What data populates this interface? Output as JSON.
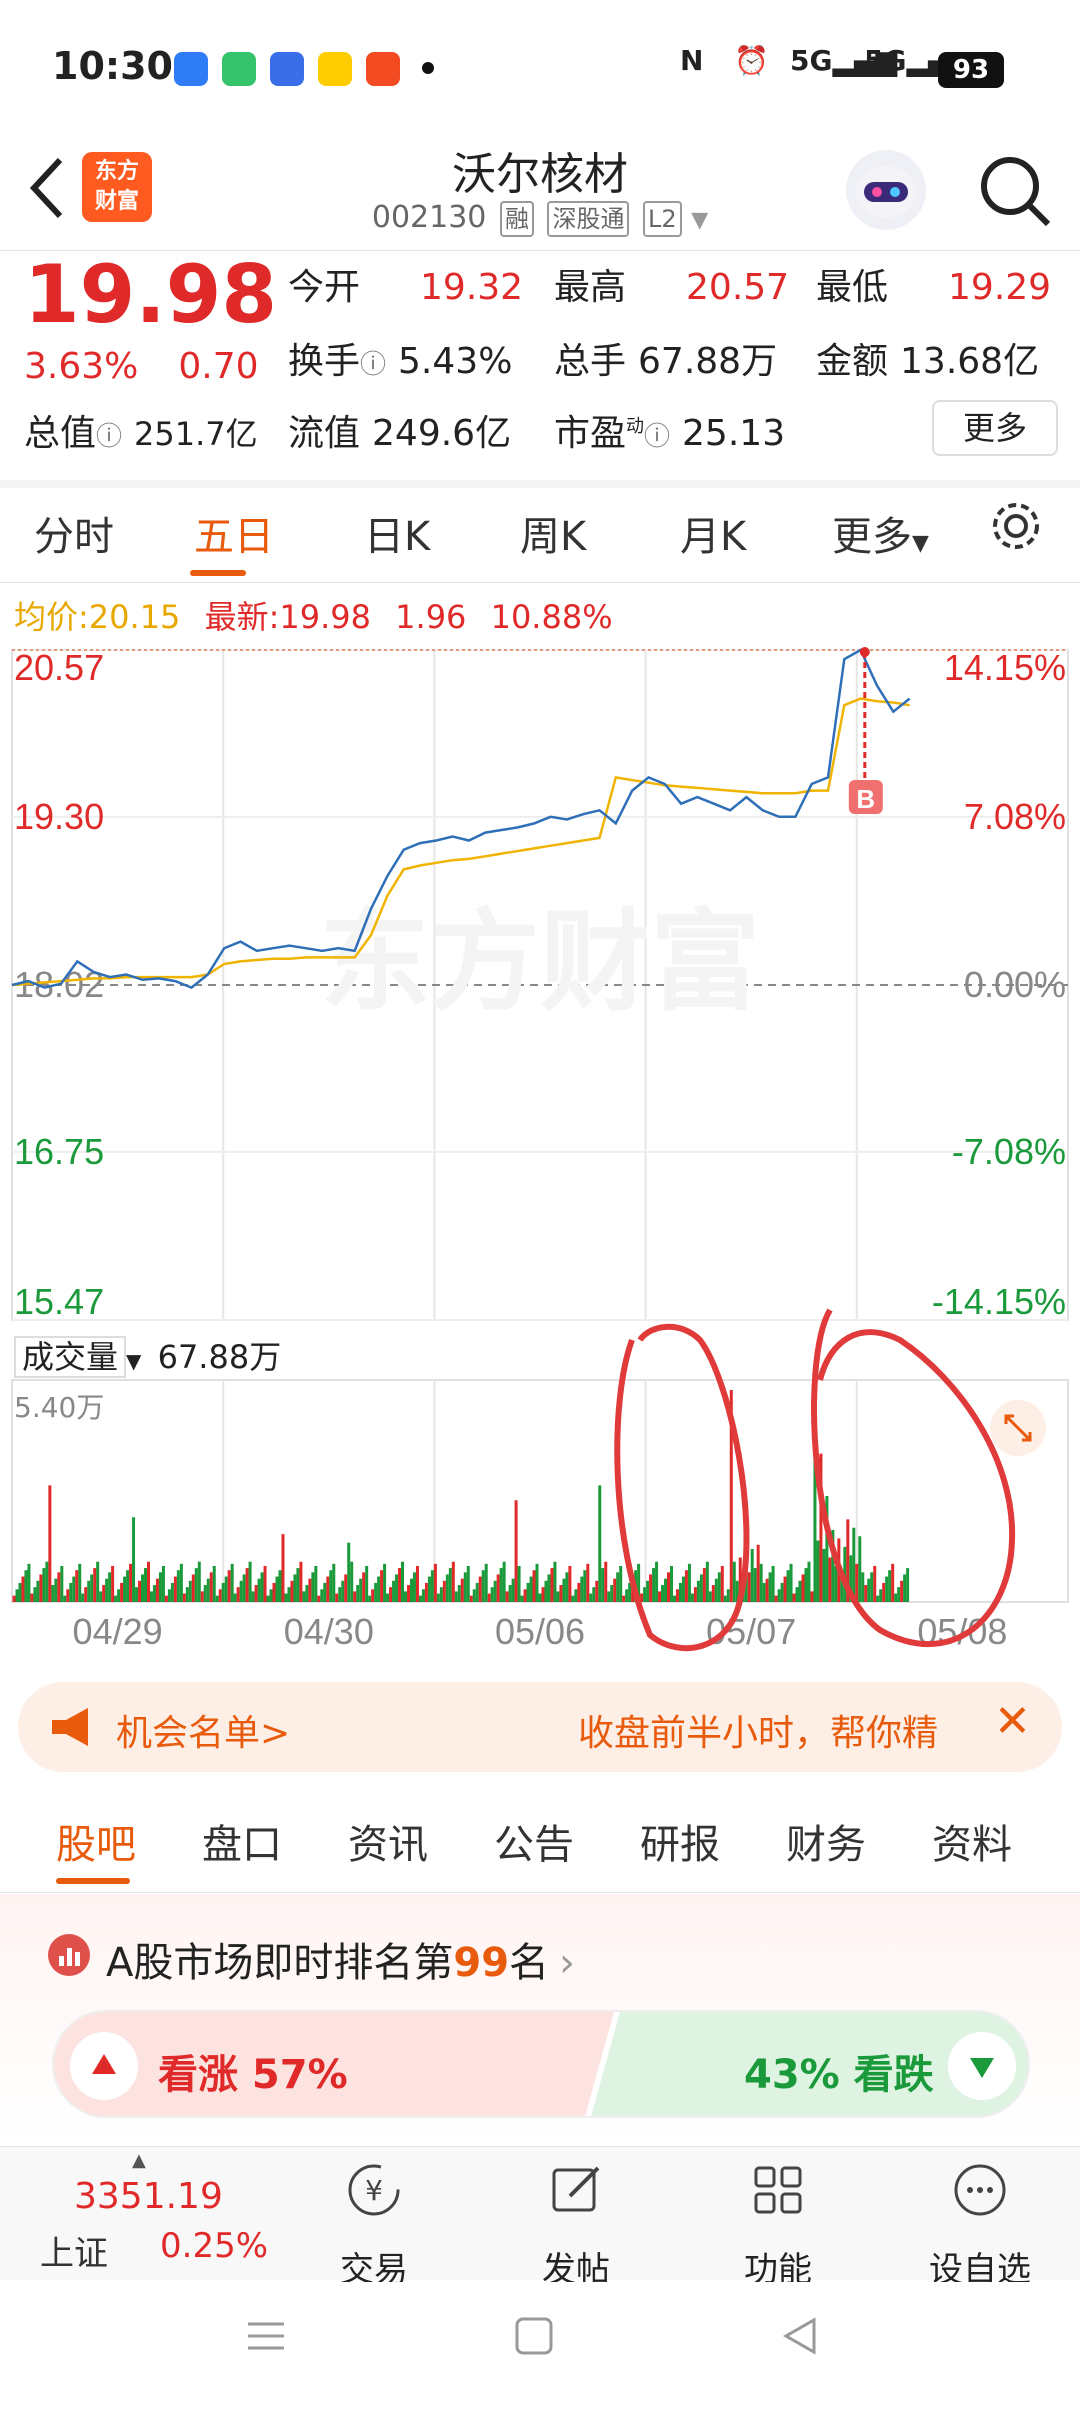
{
  "status": {
    "time": "10:30",
    "battery": "93",
    "signal1": "5G",
    "signal2": "5G"
  },
  "header": {
    "logo_line1": "东方",
    "logo_line2": "财富",
    "stock_name": "沃尔核材",
    "stock_code": "002130",
    "tags": [
      "融",
      "深股通",
      "L2"
    ],
    "back_icon": "back-chevron-icon",
    "search_icon": "search-icon"
  },
  "quote": {
    "price": "19.98",
    "pct": "3.63%",
    "change": "0.70",
    "open_label": "今开",
    "open": "19.32",
    "high_label": "最高",
    "high": "20.57",
    "low_label": "最低",
    "low": "19.29",
    "turnover_label": "换手",
    "turnover": "5.43%",
    "volume_label": "总手",
    "volume": "67.88万",
    "amount_label": "金额",
    "amount": "13.68亿",
    "mcap_label": "总值",
    "mcap": "251.7亿",
    "float_label": "流值",
    "float": "249.6亿",
    "pe_label": "市盈",
    "pe_sup": "动",
    "pe": "25.13",
    "more": "更多"
  },
  "tabs": [
    "分时",
    "五日",
    "日K",
    "周K",
    "月K",
    "更多"
  ],
  "active_tab": "五日",
  "info": {
    "avg_label": "均价:",
    "avg": "20.15",
    "latest_label": "最新:",
    "latest": "19.98",
    "latest_chg": "1.96",
    "latest_pct": "10.88%"
  },
  "chart_data": {
    "type": "line",
    "title": "",
    "x": [
      "04/29",
      "04/30",
      "05/06",
      "05/07",
      "05/08"
    ],
    "y_left_ticks": [
      "20.57",
      "19.30",
      "18.02",
      "16.75",
      "15.47"
    ],
    "y_right_ticks": [
      "14.15%",
      "7.08%",
      "0.00%",
      "-7.08%",
      "-14.15%"
    ],
    "ylim": [
      15.47,
      20.57
    ],
    "reference": 18.02,
    "series": [
      {
        "values": [
          18.02,
          18.05,
          18.0,
          18.03,
          18.2,
          18.12,
          18.08,
          18.1,
          18.06,
          18.07,
          18.05,
          18.0,
          18.1,
          18.3,
          18.35,
          18.28,
          18.3,
          18.32,
          18.3,
          18.28,
          18.3,
          18.28,
          18.6,
          18.85,
          19.05,
          19.1,
          19.12,
          19.15,
          19.12,
          19.18,
          19.2,
          19.22,
          19.25,
          19.3,
          19.28,
          19.32,
          19.35,
          19.25,
          19.5,
          19.6,
          19.55,
          19.4,
          19.45,
          19.4,
          19.35,
          19.45,
          19.35,
          19.3,
          19.3,
          19.55,
          19.6,
          20.5,
          20.57,
          20.3,
          20.1,
          20.2
        ]
      },
      {
        "values": [
          18.02,
          18.03,
          18.04,
          18.05,
          18.06,
          18.07,
          18.07,
          18.08,
          18.08,
          18.08,
          18.08,
          18.08,
          18.1,
          18.18,
          18.2,
          18.21,
          18.22,
          18.22,
          18.23,
          18.23,
          18.23,
          18.23,
          18.4,
          18.7,
          18.9,
          18.93,
          18.95,
          18.97,
          18.98,
          19.0,
          19.02,
          19.04,
          19.06,
          19.08,
          19.1,
          19.12,
          19.14,
          19.6,
          19.58,
          19.56,
          19.54,
          19.53,
          19.52,
          19.51,
          19.5,
          19.49,
          19.48,
          19.48,
          19.48,
          19.5,
          19.5,
          20.15,
          20.2,
          20.18,
          20.17,
          20.15
        ]
      }
    ],
    "volume_label": "成交量",
    "volume_total": "67.88万",
    "volume_max": "5.40万",
    "marker": "B"
  },
  "banner": {
    "left": "机会名单>",
    "right": "收盘前半小时，帮你精",
    "close_icon": "close-icon"
  },
  "bottom_tabs": [
    "股吧",
    "盘口",
    "资讯",
    "公告",
    "研报",
    "财务",
    "资料"
  ],
  "active_bottom_tab": "股吧",
  "rank": {
    "prefix": "A股市场即时排名第",
    "num": "99",
    "suffix": "名"
  },
  "vote": {
    "up_label": "看涨 57%",
    "down_label": "43% 看跌",
    "up_pct": 57,
    "down_pct": 43
  },
  "bottombar": {
    "index_value": "3351.19",
    "index_name": "上证",
    "index_pct": "0.25%",
    "items": [
      "交易",
      "发帖",
      "功能",
      "设自选"
    ]
  },
  "colors": {
    "red": "#e02a2a",
    "green": "#1a9a3a",
    "accent": "#e85a0c",
    "price_line": "#2e6fb7",
    "avg_line": "#f0b400"
  }
}
